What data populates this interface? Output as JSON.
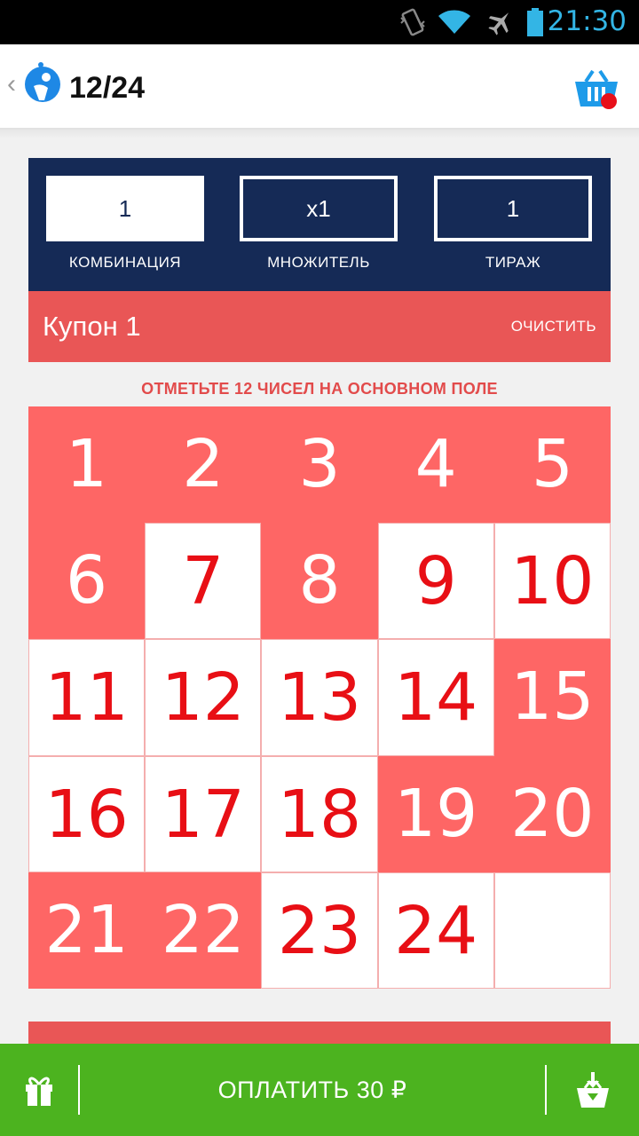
{
  "status_bar": {
    "time": "21:30",
    "icons": [
      "vibrate-icon",
      "wifi-icon",
      "airplane-icon",
      "battery-icon"
    ],
    "color": "#33b5e5"
  },
  "header": {
    "title": "12/24",
    "icons": [
      "back-chevron-icon",
      "lottery-logo-icon",
      "shopping-basket-icon"
    ]
  },
  "ticket_options": {
    "combination": {
      "value": "1",
      "label": "КОМБИНАЦИЯ"
    },
    "multiplier": {
      "value": "x1",
      "label": "МНОЖИТЕЛЬ"
    },
    "draws": {
      "value": "1",
      "label": "ТИРАЖ"
    },
    "color": "#152a56"
  },
  "coupon": {
    "name": "Купон 1",
    "clear_label": "ОЧИСТИТЬ",
    "color": "#e95656"
  },
  "hint": "ОТМЕТЬТЕ 12 ЧИСЕЛ НА ОСНОВНОМ ПОЛЕ",
  "number_grid": {
    "numbers": [
      "1",
      "2",
      "3",
      "4",
      "5",
      "6",
      "7",
      "8",
      "9",
      "10",
      "11",
      "12",
      "13",
      "14",
      "15",
      "16",
      "17",
      "18",
      "19",
      "20",
      "21",
      "22",
      "23",
      "24"
    ],
    "selected": [
      "1",
      "2",
      "3",
      "4",
      "5",
      "6",
      "8",
      "15",
      "19",
      "20",
      "21",
      "22"
    ],
    "selected_color": "#fe6665",
    "number_color": "#e80f15"
  },
  "pay_bar": {
    "label": "ОПЛАТИТЬ 30 ₽",
    "icons": [
      "gift-icon",
      "basket-download-icon"
    ],
    "color": "#4cb31f"
  }
}
